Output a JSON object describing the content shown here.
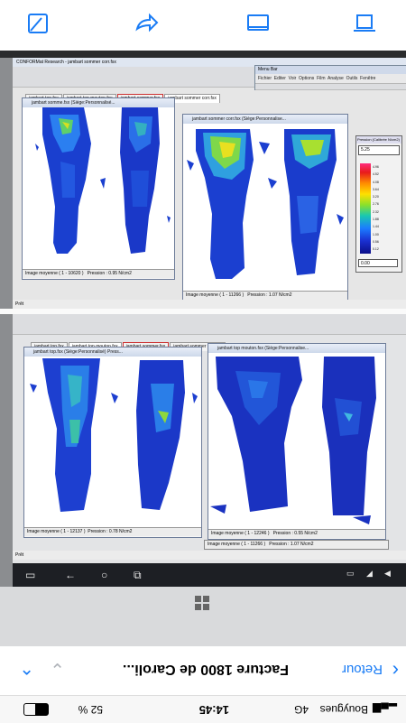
{
  "ios_toolbar": {
    "icons": [
      "markup-icon",
      "share-forward-icon",
      "tabs-icon",
      "laptop-icon"
    ],
    "accent": "#1a7cf5"
  },
  "app": {
    "title": "CONFORMat Research - jambart sommer corr.fsx",
    "floating_menu_title": "Menu Bar",
    "menu_items": [
      "Fichier",
      "Editer",
      "Voir",
      "Options",
      "Film",
      "Analyse",
      "Outils",
      "Fenêtre"
    ]
  },
  "screen_top": {
    "tabs": [
      "jambart top.fsx",
      "jambart top mouton.fsx",
      "jambart sommer.fsx",
      "jambart sommer corr.fsx"
    ],
    "active_tab": 3,
    "left_window": {
      "title": "jambart somme.fsx (Siège:Personnalisé...",
      "status_left": "Image moyenne ( 1 - 10620 )",
      "status_right": "Pression : 0.95 N/cm2"
    },
    "right_window": {
      "title": "jambart sommer corr.fsx (Siège:Personnalise...",
      "status_left": "Image moyenne ( 1 - 11266 )",
      "status_right": "Pression : 1.07 N/cm2"
    },
    "legend": {
      "title": "Pression (Calibrée N/cm2)",
      "max_value": "5.25",
      "min_value": "0.00",
      "ticks": [
        "4.96",
        "4.52",
        "4.08",
        "3.64",
        "3.20",
        "2.76",
        "2.32",
        "1.88",
        "1.44",
        "1.00",
        "0.56",
        "0.12"
      ]
    },
    "statusbar": "Prêt"
  },
  "screen_bottom": {
    "tabs": [
      "jambart top.fsx",
      "jambart top mouton.fsx",
      "jambart sommer.fsx",
      "jambart sommer corr.fsx"
    ],
    "active_tab": 1,
    "left_window": {
      "title": "jambart top.fsx (Siège:Personnalisé) Press...",
      "status_left": "Image moyenne ( 1 - 12137 )",
      "status_right": "Pression : 0.78 N/cm2"
    },
    "right_window": {
      "title": "jambart top mouton.fsx (Siège:Personnalise...",
      "status_left": "Image moyenne ( 1 - 12246 )",
      "status_right": "Pression : 0.55 N/cm2"
    },
    "behind_status_left": "Image moyenne ( 1 - 11266 )",
    "behind_status_right": "Pression : 1.07 N/cm2",
    "statusbar": "Prêt"
  },
  "safari_bottom": {
    "title": "Facture 1800 de Caroli...",
    "back_label": "Retour"
  },
  "ios_status": {
    "carrier": "Bouygues",
    "network": "4G",
    "time": "14:45",
    "battery": "52 %"
  }
}
